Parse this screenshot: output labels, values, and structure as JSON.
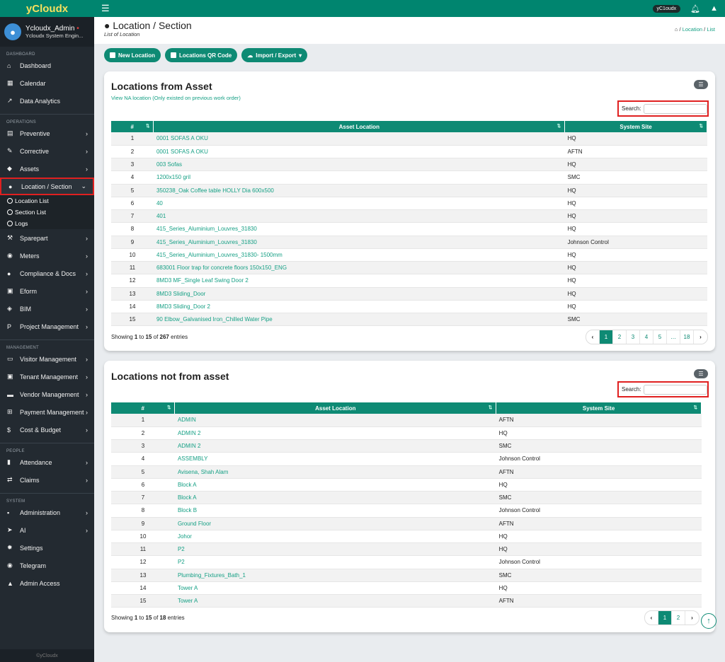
{
  "app": {
    "brand": "yCloudx",
    "top_pill": "yC1oudx"
  },
  "user": {
    "name": "Ycloudx_Admin",
    "dot": "•",
    "role": "Ycloudx System Engin..."
  },
  "sidebar": {
    "dashboard_head": "DASHBOARD",
    "dashboard": [
      {
        "label": "Dashboard",
        "icon": "home-icon",
        "glyph": "⌂"
      },
      {
        "label": "Calendar",
        "icon": "calendar-icon",
        "glyph": "▦"
      },
      {
        "label": "Data Analytics",
        "icon": "chart-icon",
        "glyph": "↗"
      }
    ],
    "operations_head": "OPERATIONS",
    "operations": [
      {
        "label": "Preventive",
        "icon": "preventive-icon",
        "glyph": "▤"
      },
      {
        "label": "Corrective",
        "icon": "wrench-icon",
        "glyph": "✎"
      },
      {
        "label": "Assets",
        "icon": "tag-icon",
        "glyph": "◆"
      },
      {
        "label": "Location / Section",
        "icon": "globe-icon",
        "glyph": "●"
      }
    ],
    "location_sub": [
      "Location List",
      "Section List",
      "Logs"
    ],
    "operations2": [
      {
        "label": "Sparepart",
        "icon": "tools-icon",
        "glyph": "⚒"
      },
      {
        "label": "Meters",
        "icon": "gauge-icon",
        "glyph": "◉"
      },
      {
        "label": "Compliance & Docs",
        "icon": "circle-icon",
        "glyph": "●"
      },
      {
        "label": "Eform",
        "icon": "form-icon",
        "glyph": "▣"
      },
      {
        "label": "BIM",
        "icon": "cube-icon",
        "glyph": "◈"
      },
      {
        "label": "Project Management",
        "icon": "project-icon",
        "glyph": "P"
      }
    ],
    "management_head": "MANAGEMENT",
    "management": [
      {
        "label": "Visitor Management",
        "icon": "id-card-icon",
        "glyph": "▭"
      },
      {
        "label": "Tenant Management",
        "icon": "building-icon",
        "glyph": "▣"
      },
      {
        "label": "Vendor Management",
        "icon": "vendor-icon",
        "glyph": "▬"
      },
      {
        "label": "Payment Management",
        "icon": "cart-icon",
        "glyph": "⊞"
      },
      {
        "label": "Cost & Budget",
        "icon": "dollar-icon",
        "glyph": "$"
      }
    ],
    "people_head": "PEOPLE",
    "people": [
      {
        "label": "Attendance",
        "icon": "attendance-icon",
        "glyph": "▮"
      },
      {
        "label": "Claims",
        "icon": "exchange-icon",
        "glyph": "⇄"
      }
    ],
    "system_head": "SYSTEM",
    "system": [
      {
        "label": "Administration",
        "icon": "admin-icon",
        "glyph": "▪"
      },
      {
        "label": "AI",
        "icon": "plane-icon",
        "glyph": "➤"
      },
      {
        "label": "Settings",
        "icon": "gear-icon",
        "glyph": "✹"
      },
      {
        "label": "Telegram",
        "icon": "telegram-icon",
        "glyph": "◉"
      },
      {
        "label": "Admin Access",
        "icon": "lock-icon",
        "glyph": "▲"
      }
    ],
    "footer": "©yCloudx"
  },
  "page": {
    "title": "Location / Section",
    "subtitle": "List of Location",
    "bc_location": "Location",
    "bc_list": "List"
  },
  "buttons": {
    "new": "New Location",
    "qr": "Locations QR Code",
    "import": "Import / Export"
  },
  "card1": {
    "title": "Locations from Asset",
    "na_link": "View NA location (Only existed on previous work order)",
    "search_label": "Search:",
    "headers": [
      "#",
      "Asset Location",
      "System Site"
    ],
    "rows": [
      [
        "1",
        "0001 SOFAS A OKU",
        "HQ"
      ],
      [
        "2",
        "0001 SOFAS A OKU",
        "AFTN"
      ],
      [
        "3",
        "003 Sofas",
        "HQ"
      ],
      [
        "4",
        "1200x150 gril",
        "SMC"
      ],
      [
        "5",
        "350238_Oak Coffee table HOLLY Dia 600x500",
        "HQ"
      ],
      [
        "6",
        "40",
        "HQ"
      ],
      [
        "7",
        "401",
        "HQ"
      ],
      [
        "8",
        "415_Series_Aluminium_Louvres_31830",
        "HQ"
      ],
      [
        "9",
        "415_Series_Aluminium_Louvres_31830",
        "Johnson Control"
      ],
      [
        "10",
        "415_Series_Aluminium_Louvres_31830- 1500mm",
        "HQ"
      ],
      [
        "11",
        "683001 Floor trap for concrete floors 150x150_ENG",
        "HQ"
      ],
      [
        "12",
        "8MD3 MF_Single Leaf Swing Door 2",
        "HQ"
      ],
      [
        "13",
        "8MD3 Sliding_Door",
        "HQ"
      ],
      [
        "14",
        "8MD3 Sliding_Door 2",
        "HQ"
      ],
      [
        "15",
        "90 Elbow_Galvanised Iron_Chilled Water Pipe",
        "SMC"
      ]
    ],
    "showing_pre": "Showing ",
    "from": "1",
    "to_word": " to ",
    "to": "15",
    "of_word": " of ",
    "total": "267",
    "entries": " entries",
    "pages": [
      "‹",
      "1",
      "2",
      "3",
      "4",
      "5",
      "…",
      "18",
      "›"
    ]
  },
  "card2": {
    "title": "Locations not from asset",
    "search_label": "Search:",
    "headers": [
      "#",
      "Asset Location",
      "System Site"
    ],
    "rows": [
      [
        "1",
        "ADMIN",
        "AFTN"
      ],
      [
        "2",
        "ADMIN 2",
        "HQ"
      ],
      [
        "3",
        "ADMIN 2",
        "SMC"
      ],
      [
        "4",
        "ASSEMBLY",
        "Johnson Control"
      ],
      [
        "5",
        "Avisena, Shah Alam",
        "AFTN"
      ],
      [
        "6",
        "Block A",
        "HQ"
      ],
      [
        "7",
        "Block A",
        "SMC"
      ],
      [
        "8",
        "Block B",
        "Johnson Control"
      ],
      [
        "9",
        "Ground Floor",
        "AFTN"
      ],
      [
        "10",
        "Johor",
        "HQ"
      ],
      [
        "11",
        "P2",
        "HQ"
      ],
      [
        "12",
        "P2",
        "Johnson Control"
      ],
      [
        "13",
        "Plumbing_Fixtures_Bath_1",
        "SMC"
      ],
      [
        "14",
        "Tower A",
        "HQ"
      ],
      [
        "15",
        "Tower A",
        "AFTN"
      ]
    ],
    "showing_pre": "Showing ",
    "from": "1",
    "to_word": " to ",
    "to": "15",
    "of_word": " of ",
    "total": "18",
    "entries": " entries",
    "pages": [
      "‹",
      "1",
      "2",
      "›"
    ]
  }
}
